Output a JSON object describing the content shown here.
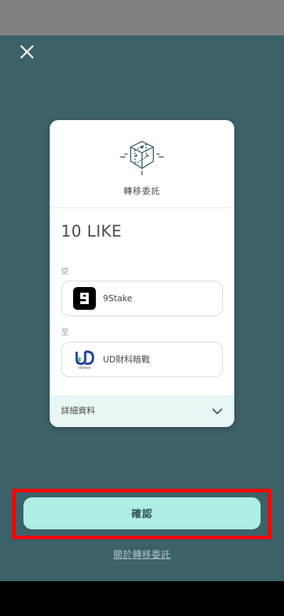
{
  "card": {
    "title": "轉移委託",
    "amount": "10 LIKE",
    "from_label": "從",
    "to_label": "至",
    "from_validator": {
      "name": "9Stake",
      "icon": "9stake-logo-icon"
    },
    "to_validator": {
      "name": "UD財科暗戰",
      "icon": "udomain-logo-icon",
      "logo_text": "UDomain"
    },
    "details_label": "詳細資料"
  },
  "actions": {
    "confirm_label": "確認",
    "about_link": "關於轉移委託"
  },
  "colors": {
    "background": "#3d6168",
    "confirm_button": "#aeeee3",
    "details_row": "#e8f7f5",
    "highlight": "#ff0000"
  }
}
